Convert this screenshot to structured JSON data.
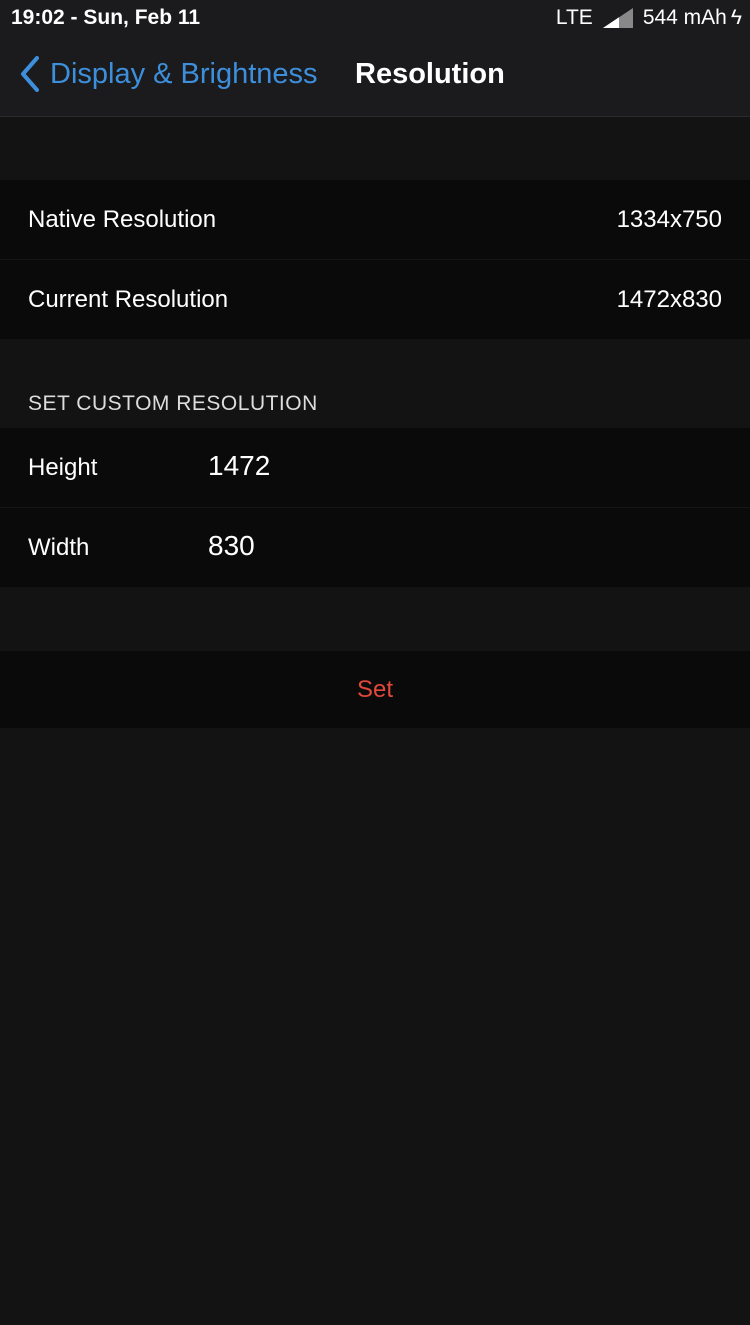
{
  "status": {
    "time": "19:02 - Sun, Feb 11",
    "network": "LTE",
    "battery": "544 mAh"
  },
  "nav": {
    "back": "Display & Brightness",
    "title": "Resolution"
  },
  "info": [
    {
      "label": "Native Resolution",
      "value": "1334x750"
    },
    {
      "label": "Current Resolution",
      "value": "1472x830"
    }
  ],
  "custom": {
    "header": "SET CUSTOM RESOLUTION",
    "height_label": "Height",
    "height_value": "1472",
    "width_label": "Width",
    "width_value": "830"
  },
  "set_label": "Set"
}
